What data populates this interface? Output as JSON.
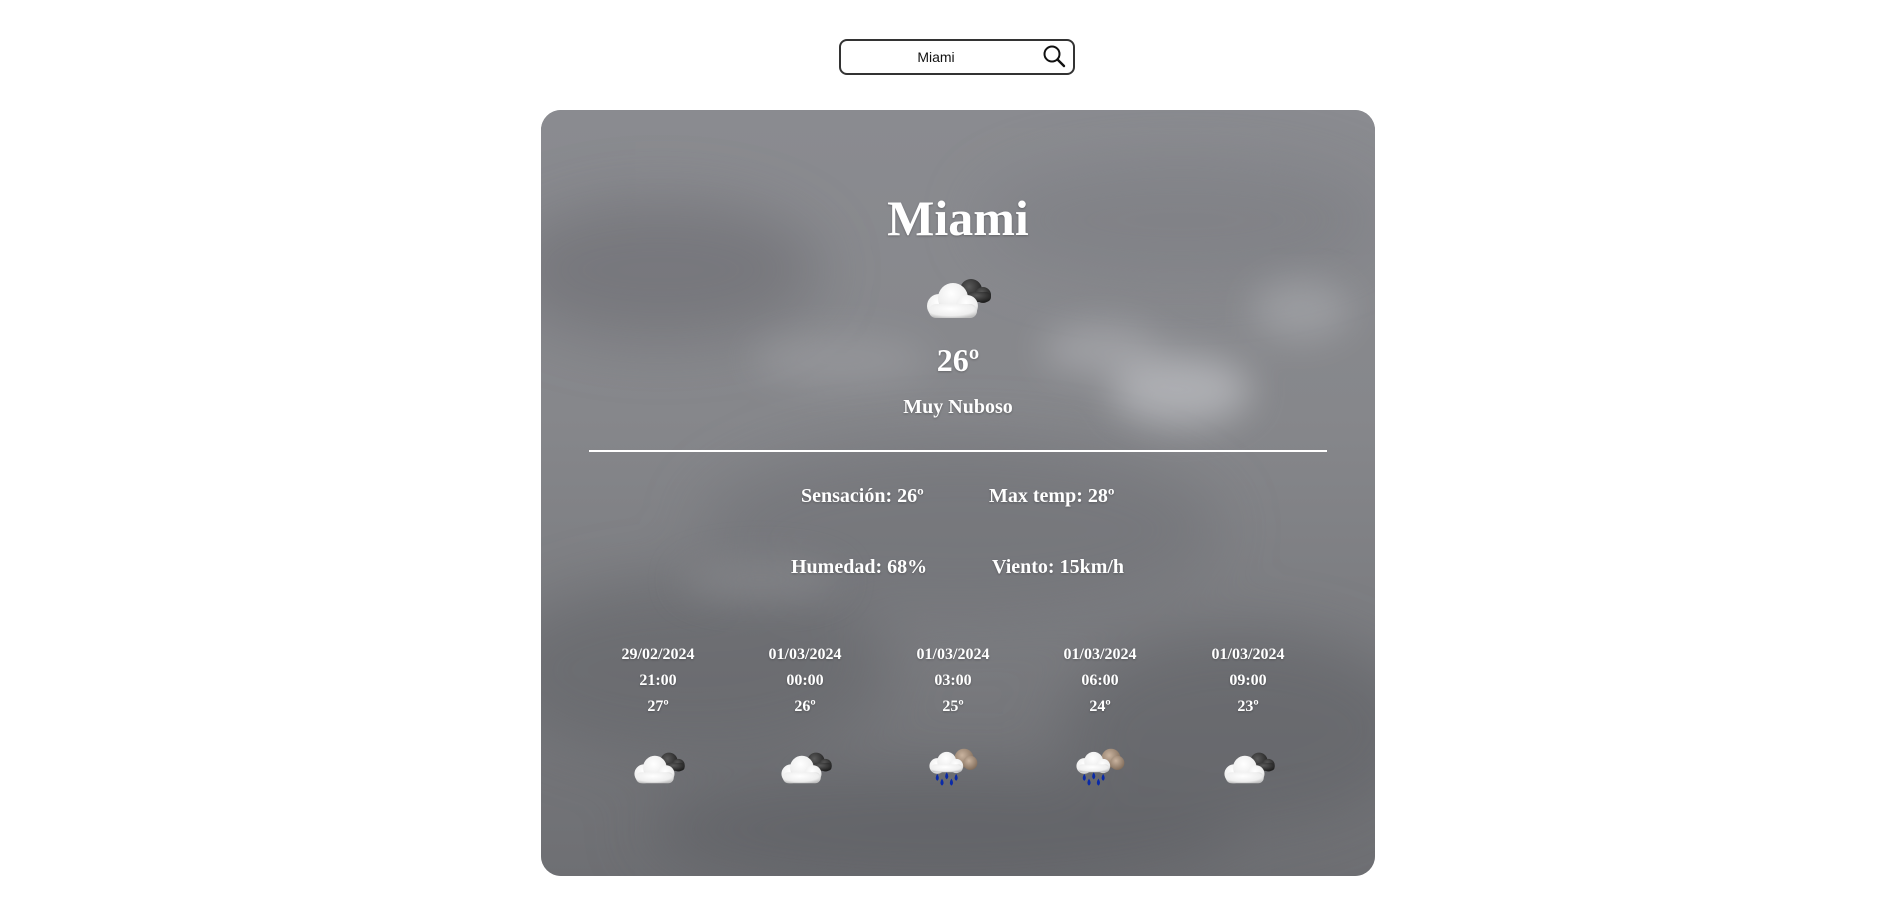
{
  "search": {
    "value": "Miami"
  },
  "current": {
    "city": "Miami",
    "icon": "cloudy-icon",
    "temperature": "26º",
    "description": "Muy Nuboso"
  },
  "details": {
    "feels_like": "Sensación: 26º",
    "max_temp": "Max temp: 28º",
    "humidity": "Humedad: 68%",
    "wind": "Viento: 15km/h"
  },
  "forecast": [
    {
      "date": "29/02/2024",
      "time": "21:00",
      "temp": "27º",
      "icon": "cloudy-icon"
    },
    {
      "date": "01/03/2024",
      "time": "00:00",
      "temp": "26º",
      "icon": "cloudy-icon"
    },
    {
      "date": "01/03/2024",
      "time": "03:00",
      "temp": "25º",
      "icon": "rain-icon"
    },
    {
      "date": "01/03/2024",
      "time": "06:00",
      "temp": "24º",
      "icon": "rain-icon"
    },
    {
      "date": "01/03/2024",
      "time": "09:00",
      "temp": "23º",
      "icon": "cloudy-icon"
    }
  ],
  "colors": {
    "card_background": "#85868b",
    "text": "#ffffff",
    "rain_drops": "#0a2aa8"
  }
}
